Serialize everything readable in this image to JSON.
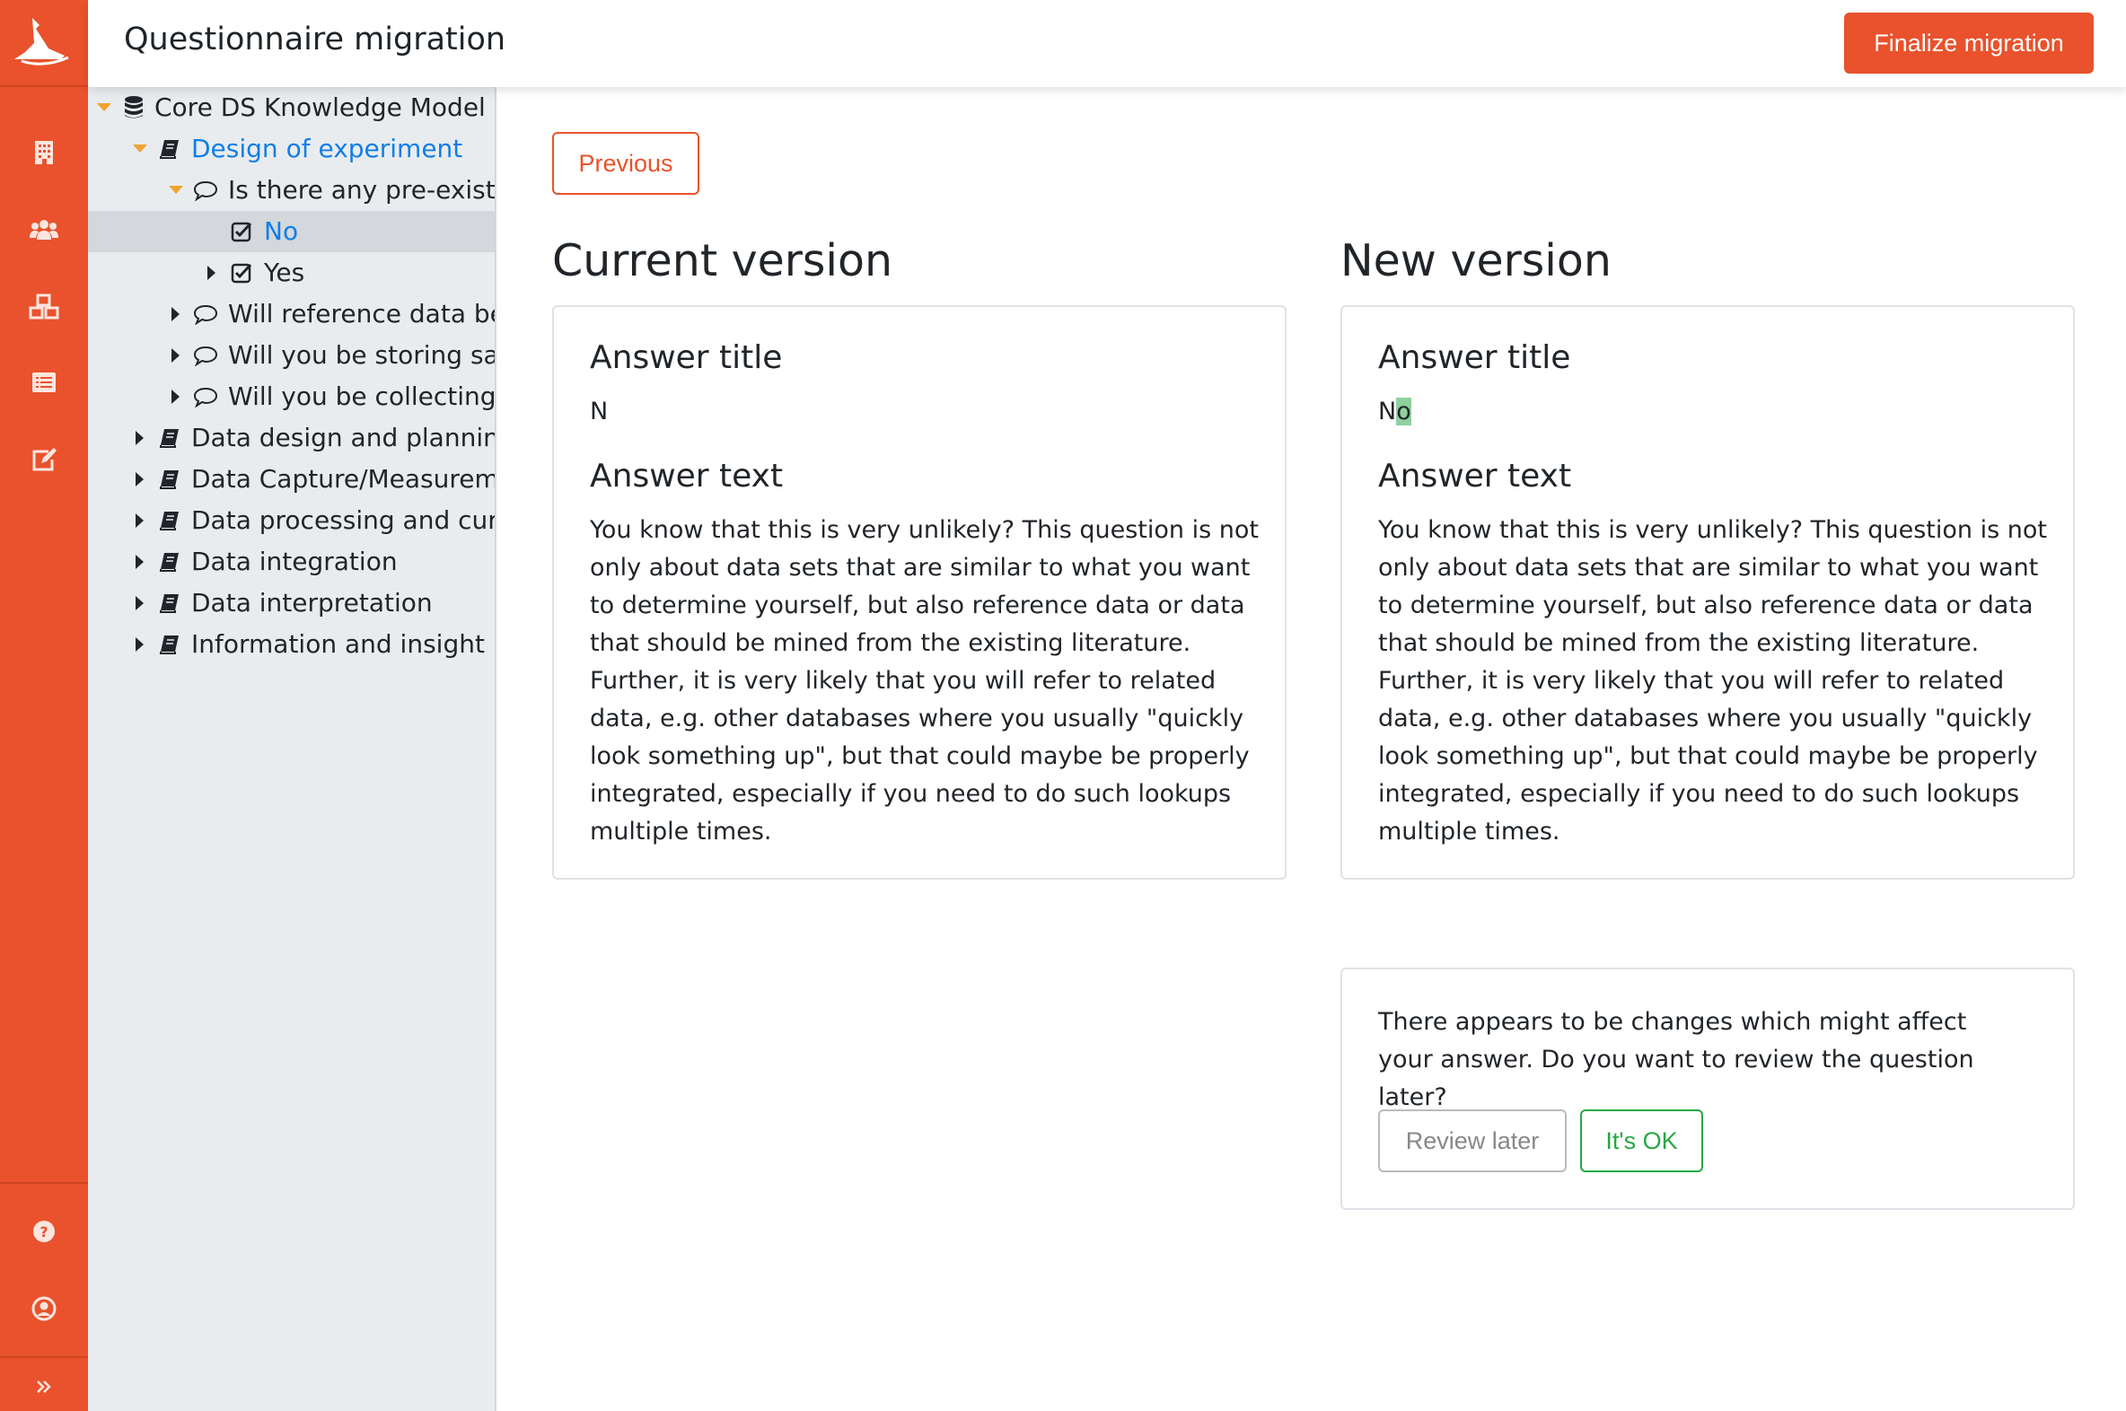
{
  "header": {
    "title": "Questionnaire migration",
    "finalize_label": "Finalize migration"
  },
  "sidebar": {
    "items": [
      {
        "icon": "building-icon",
        "label": ""
      },
      {
        "icon": "users-icon",
        "label": ""
      },
      {
        "icon": "cubes-icon",
        "label": ""
      },
      {
        "icon": "list-icon",
        "label": ""
      },
      {
        "icon": "edit-icon",
        "label": ""
      }
    ],
    "bottom": [
      {
        "icon": "question-circle-icon"
      },
      {
        "icon": "user-circle-icon"
      },
      {
        "icon": "double-chevron-right-icon"
      }
    ],
    "accent_color": "#e9522c"
  },
  "tree": {
    "nodes": [
      {
        "label": "Core DS Knowledge Model",
        "icon": "database-icon",
        "expanded": true
      },
      {
        "label": "Design of experiment",
        "icon": "book-icon",
        "expanded": true,
        "link": true
      },
      {
        "label": "Is there any pre-existing",
        "icon": "comment-icon",
        "expanded": true
      },
      {
        "label": "No",
        "icon": "check-square-icon",
        "selected": true,
        "link": true
      },
      {
        "label": "Yes",
        "icon": "check-square-icon",
        "expanded": false
      },
      {
        "label": "Will reference data be c",
        "icon": "comment-icon",
        "expanded": false
      },
      {
        "label": "Will you be storing sam",
        "icon": "comment-icon",
        "expanded": false
      },
      {
        "label": "Will you be collecting ex",
        "icon": "comment-icon",
        "expanded": false
      },
      {
        "label": "Data design and planning",
        "icon": "book-icon",
        "expanded": false
      },
      {
        "label": "Data Capture/Measuremen",
        "icon": "book-icon",
        "expanded": false
      },
      {
        "label": "Data processing and curatio",
        "icon": "book-icon",
        "expanded": false
      },
      {
        "label": "Data integration",
        "icon": "book-icon",
        "expanded": false
      },
      {
        "label": "Data interpretation",
        "icon": "book-icon",
        "expanded": false
      },
      {
        "label": "Information and insight",
        "icon": "book-icon",
        "expanded": false
      }
    ]
  },
  "main": {
    "previous_label": "Previous",
    "current": {
      "heading": "Current version",
      "answer_title_label": "Answer title",
      "answer_title": "N",
      "answer_text_label": "Answer text",
      "answer_text": "You know that this is very unlikely? This question is not only about data sets that are similar to what you want to determine yourself, but also reference data or data that should be mined from the existing literature. Further, it is very likely that you will refer to related data, e.g. other databases where you usually \"quickly look something up\", but that could maybe be properly integrated, especially if you need to do such lookups multiple times."
    },
    "new": {
      "heading": "New version",
      "answer_title_label": "Answer title",
      "answer_title_kept": "N",
      "answer_title_added": "o",
      "answer_text_label": "Answer text",
      "answer_text": "You know that this is very unlikely? This question is not only about data sets that are similar to what you want to determine yourself, but also reference data or data that should be mined from the existing literature. Further, it is very likely that you will refer to related data, e.g. other databases where you usually \"quickly look something up\", but that could maybe be properly integrated, especially if you need to do such lookups multiple times."
    },
    "notice": {
      "text": "There appears to be changes which might affect your answer. Do you want to review the question later?",
      "review_label": "Review later",
      "ok_label": "It's OK"
    }
  }
}
